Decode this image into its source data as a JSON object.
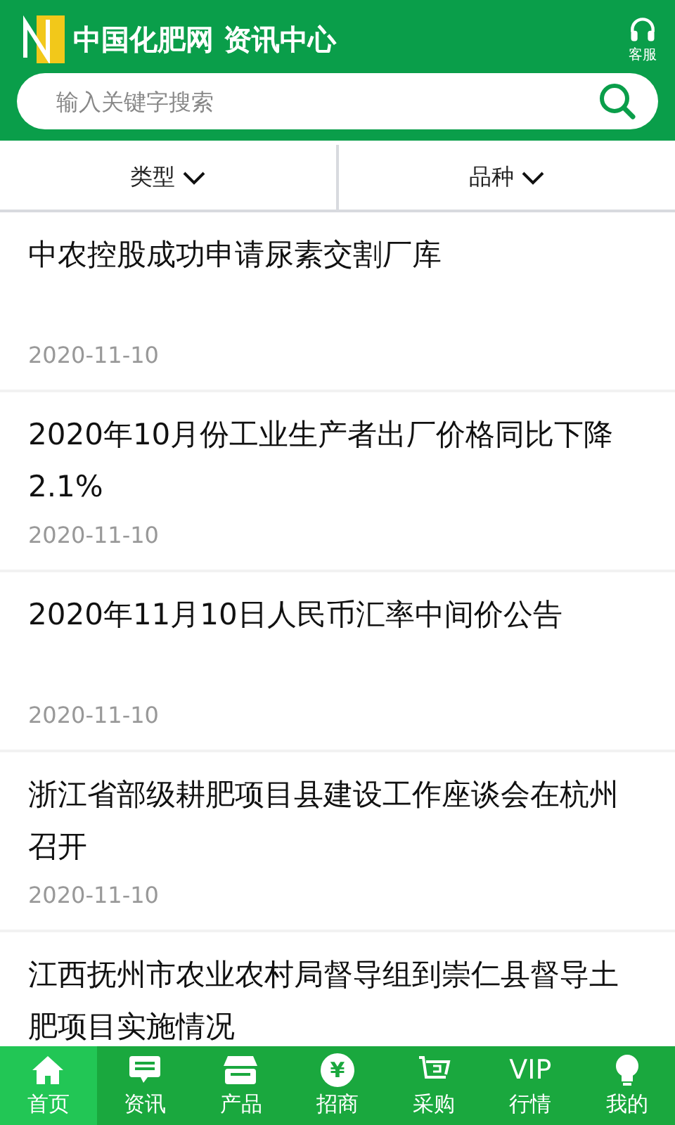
{
  "header": {
    "title": "中国化肥网 资讯中心",
    "service_label": "客服"
  },
  "search": {
    "placeholder": "输入关键字搜索"
  },
  "filters": [
    {
      "label": "类型"
    },
    {
      "label": "品种"
    }
  ],
  "news": [
    {
      "title": "中农控股成功申请尿素交割厂库",
      "date": "2020-11-10"
    },
    {
      "title": "2020年10月份工业生产者出厂价格同比下降2.1%",
      "date": "2020-11-10"
    },
    {
      "title": "2020年11月10日人民币汇率中间价公告",
      "date": "2020-11-10"
    },
    {
      "title": "浙江省部级耕肥项目县建设工作座谈会在杭州召开",
      "date": "2020-11-10"
    },
    {
      "title": "江西抚州市农业农村局督导组到崇仁县督导土肥项目实施情况"
    }
  ],
  "nav": [
    {
      "kind": "home",
      "label": "首页",
      "selected": true
    },
    {
      "kind": "chat",
      "label": "资讯",
      "selected": false
    },
    {
      "kind": "shop",
      "label": "产品",
      "selected": false
    },
    {
      "kind": "yen",
      "icon_text": "¥",
      "label": "招商",
      "selected": false
    },
    {
      "kind": "cart",
      "label": "采购",
      "selected": false
    },
    {
      "kind": "vip",
      "icon_text": "VIP",
      "label": "行情",
      "selected": false
    },
    {
      "kind": "bulb",
      "label": "我的",
      "selected": false
    }
  ]
}
